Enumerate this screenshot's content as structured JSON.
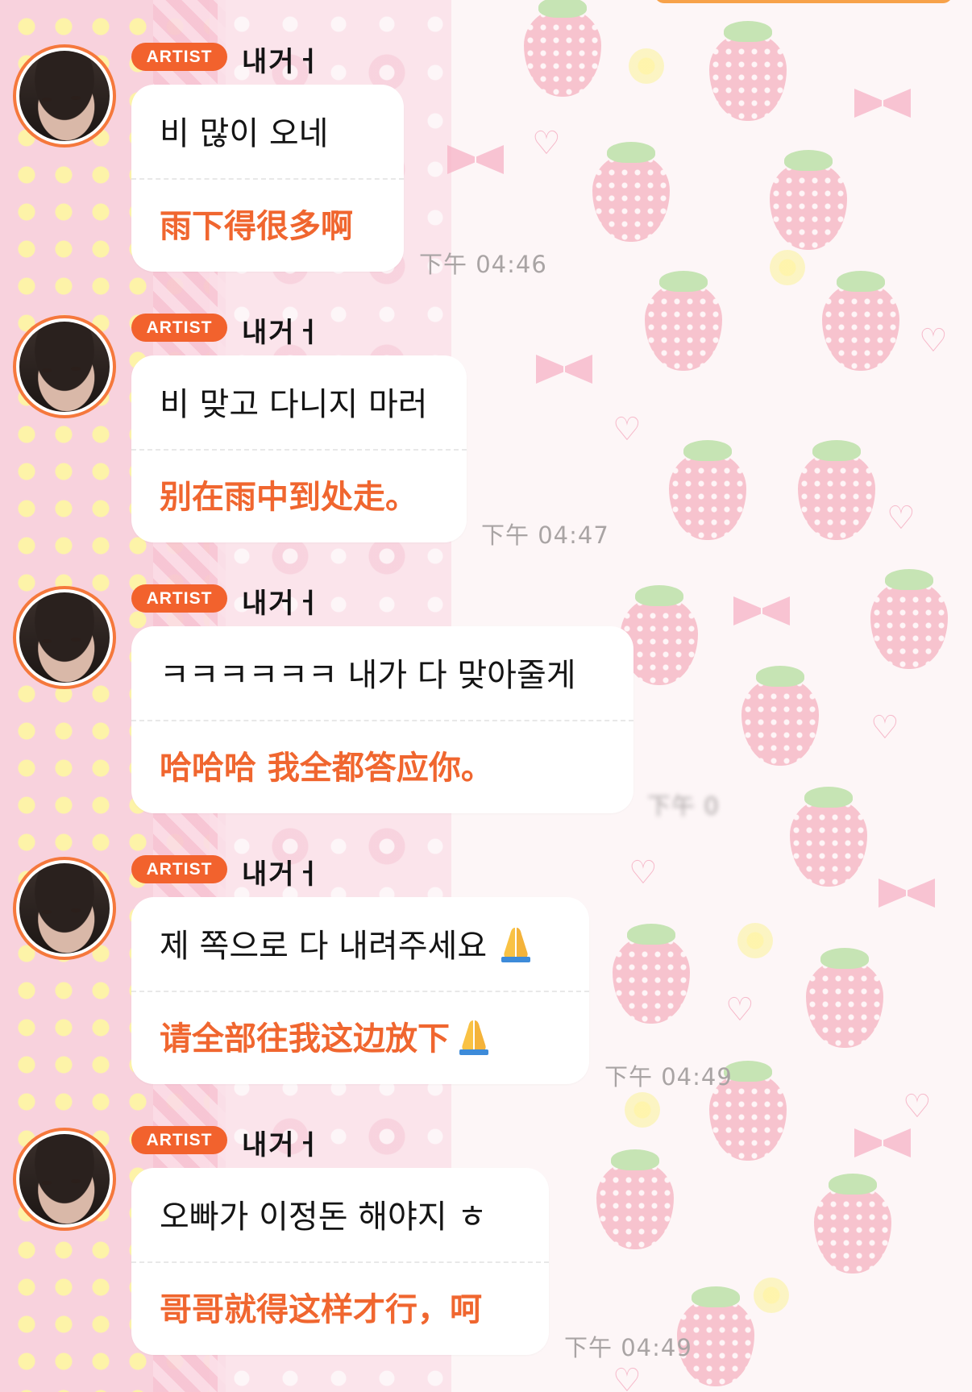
{
  "messages": [
    {
      "badge": "ARTIST",
      "sender": "내거ㅓ",
      "korean": "비 많이 오네",
      "chinese": "雨下得很多啊",
      "time": "下午 04:46",
      "has_emoji": false
    },
    {
      "badge": "ARTIST",
      "sender": "내거ㅓ",
      "korean": "비 맞고 다니지 마러",
      "chinese": "别在雨中到处走。",
      "time": "下午 04:47",
      "has_emoji": false
    },
    {
      "badge": "ARTIST",
      "sender": "내거ㅓ",
      "korean": "ㅋㅋㅋㅋㅋㅋ 내가 다 맞아줄게",
      "chinese": "哈哈哈 我全都答应你。",
      "time": "下午 0",
      "has_emoji": false
    },
    {
      "badge": "ARTIST",
      "sender": "내거ㅓ",
      "korean": "제 쪽으로 다 내려주세요",
      "chinese": "请全部往我这边放下",
      "time": "下午 04:49",
      "has_emoji": true,
      "emoji_icon": "folded-hands-icon"
    },
    {
      "badge": "ARTIST",
      "sender": "내거ㅓ",
      "korean": "오빠가 이정돈 해야지 ㅎ",
      "chinese": "哥哥就得这样才行，呵",
      "time": "下午 04:49",
      "has_emoji": false
    }
  ],
  "colors": {
    "accent": "#f2622d",
    "translation_text": "#f0662f",
    "timestamp": "#a9a4a4",
    "bubble": "#ffffff"
  }
}
